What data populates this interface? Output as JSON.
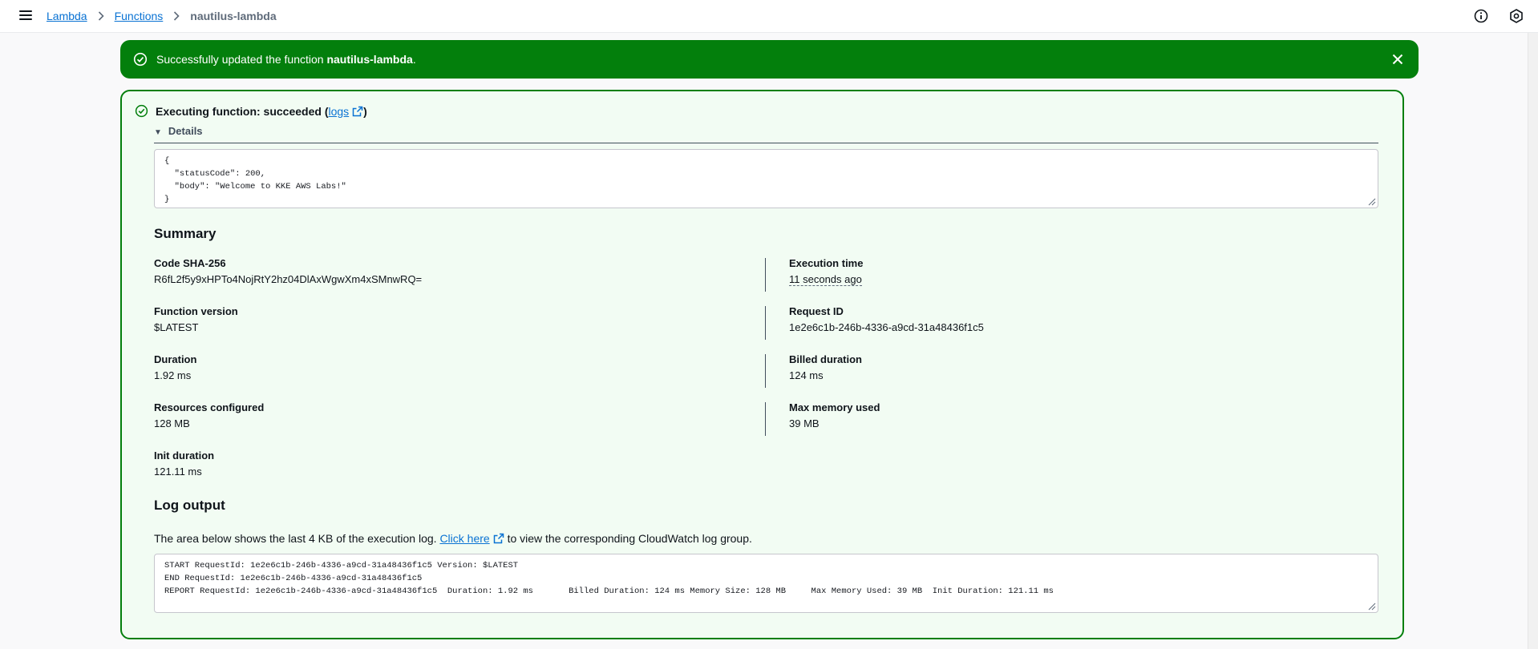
{
  "breadcrumb": {
    "root": "Lambda",
    "section": "Functions",
    "current": "nautilus-lambda"
  },
  "flash": {
    "prefix": "Successfully updated the function ",
    "function_name": "nautilus-lambda",
    "suffix": "."
  },
  "execution": {
    "title_prefix": "Executing function: succeeded (",
    "logs_link": "logs",
    "title_suffix": ")",
    "details_label": "Details",
    "response_lines": [
      "{",
      "  \"statusCode\": 200,",
      "  \"body\": \"Welcome to KKE AWS Labs!\"",
      "}"
    ]
  },
  "summary": {
    "title": "Summary",
    "code_sha_label": "Code SHA-256",
    "code_sha_value": "R6fL2f5y9xHPTo4NojRtY2hz04DlAxWgwXm4xSMnwRQ=",
    "execution_time_label": "Execution time",
    "execution_time_value": "11 seconds ago",
    "function_version_label": "Function version",
    "function_version_value": "$LATEST",
    "request_id_label": "Request ID",
    "request_id_value": "1e2e6c1b-246b-4336-a9cd-31a48436f1c5",
    "duration_label": "Duration",
    "duration_value": "1.92 ms",
    "billed_duration_label": "Billed duration",
    "billed_duration_value": "124 ms",
    "resources_label": "Resources configured",
    "resources_value": "128 MB",
    "max_memory_label": "Max memory used",
    "max_memory_value": "39 MB",
    "init_duration_label": "Init duration",
    "init_duration_value": "121.11 ms"
  },
  "log": {
    "title": "Log output",
    "desc_prefix": "The area below shows the last 4 KB of the execution log. ",
    "link": "Click here",
    "desc_suffix": " to view the corresponding CloudWatch log group.",
    "lines": [
      "START RequestId: 1e2e6c1b-246b-4336-a9cd-31a48436f1c5 Version: $LATEST",
      "END RequestId: 1e2e6c1b-246b-4336-a9cd-31a48436f1c5",
      "REPORT RequestId: 1e2e6c1b-246b-4336-a9cd-31a48436f1c5  Duration: 1.92 ms       Billed Duration: 124 ms Memory Size: 128 MB     Max Memory Used: 39 MB  Init Duration: 121.11 ms"
    ]
  },
  "icons": {
    "menu": "hamburger-menu-icon",
    "info": "info-icon",
    "settings": "hexagon-settings-icon",
    "success": "check-circle-icon",
    "close": "close-icon",
    "external": "external-link-icon"
  },
  "colors": {
    "success": "#037f0c",
    "link": "#0972d3",
    "panel_bg": "#f2fcf3"
  }
}
